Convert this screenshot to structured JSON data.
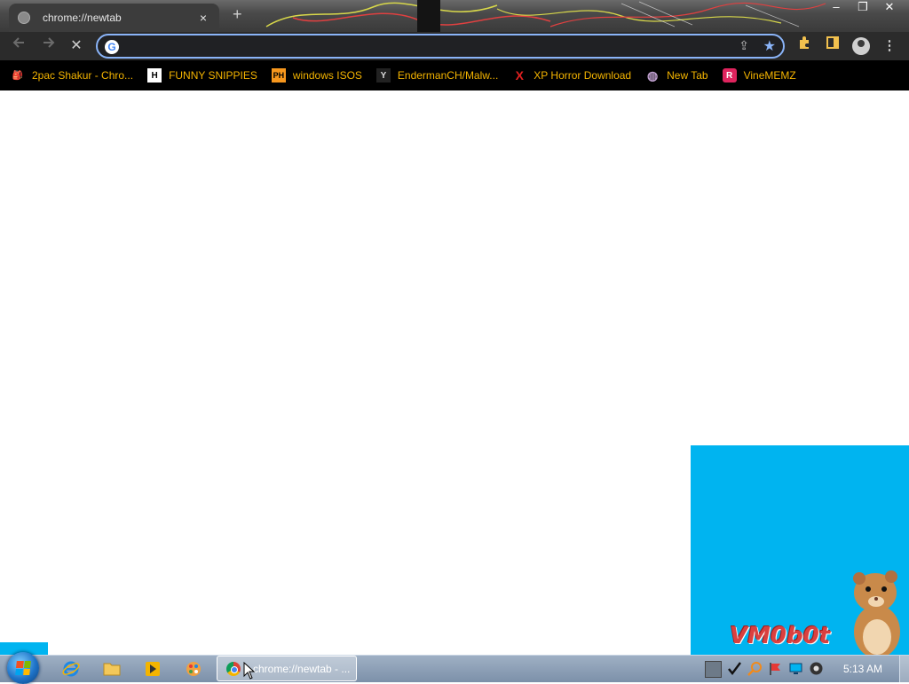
{
  "browser": {
    "tab": {
      "title": "chrome://newtab",
      "close_glyph": "×"
    },
    "new_tab_glyph": "+",
    "window_buttons": {
      "minimize": "–",
      "restore": "❐",
      "close": "✕"
    },
    "toolbar": {
      "back_icon": "arrow-left-icon",
      "forward_icon": "arrow-right-icon",
      "stop_glyph": "✕",
      "omnibox": {
        "value": "",
        "placeholder": ""
      },
      "bookmark_star": "★",
      "share_glyph": "⇪",
      "menu_glyph": "⋮"
    },
    "bookmarks": [
      {
        "label": "2pac Shakur - Chro...",
        "icon": "🎒",
        "icon_bg": "#000000"
      },
      {
        "label": "FUNNY SNIPPIES",
        "icon": "H",
        "icon_bg": "#ffffff"
      },
      {
        "label": "windows ISOS",
        "icon": "PH",
        "icon_bg": "#f7971d"
      },
      {
        "label": "EndermanCH/Malw...",
        "icon": "Y",
        "icon_bg": "#222222"
      },
      {
        "label": "XP Horror Download",
        "icon": "X",
        "icon_bg": "#000000"
      },
      {
        "label": "New Tab",
        "icon": "◍",
        "icon_bg": "#000000"
      },
      {
        "label": "VineMEMZ",
        "icon": "R",
        "icon_bg": "#e0245e"
      }
    ]
  },
  "overlay": {
    "logo": "VM0b0t"
  },
  "taskbar": {
    "active_task": "chrome://newtab - ...",
    "clock": "5:13 AM"
  },
  "colors": {
    "bookmark_text": "#f4b400",
    "omnibox_border": "#8ab4f8",
    "panel_blue": "#00b4f0",
    "logo_red": "#d94040"
  }
}
